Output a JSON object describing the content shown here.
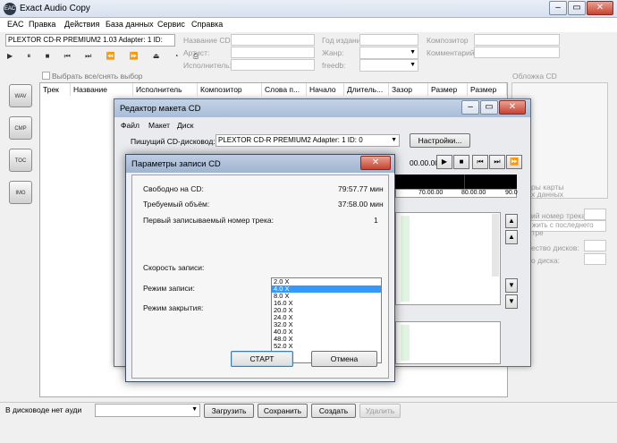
{
  "window": {
    "title": "Exact Audio Copy",
    "app_badge": "EAC"
  },
  "menu": [
    "EAC",
    "Правка",
    "Действия",
    "База данных",
    "Сервис",
    "Справка"
  ],
  "drive_combo": "PLEXTOR CD-R   PREMIUM2 1.03  Adapter: 1  ID: ",
  "cd_fields": {
    "name_label": "Название CD",
    "artist_label": "Артист:",
    "performer_label": "Исполнитель:",
    "year_label": "Год издания",
    "genre_label": "Жанр:",
    "freedb_label": "freedb:",
    "composer_label": "Композитор",
    "comment_label": "Комментарий"
  },
  "select_all": "Выбрать все/снять выбор",
  "cover_label": "Обложка CD",
  "columns": [
    "Трек",
    "Название",
    "Исполнитель",
    "Композитор",
    "Слова п...",
    "Начало",
    "Длитель...",
    "Зазор",
    "Размер",
    "Размер"
  ],
  "side_icons": [
    "WAV",
    "CMP",
    "TOC",
    "IMG"
  ],
  "right_panel": [
    "ры карты",
    "х данных",
    "ий номер трека:",
    "жить с последнего тре",
    "ество дисков:",
    "о диска:"
  ],
  "bottom": {
    "status": "В дисководе нет ауди",
    "load": "Загрузить",
    "save": "Сохранить",
    "create": "Создать",
    "delete": "Удалить"
  },
  "editor": {
    "title": "Редактор макета CD",
    "menu": [
      "Файл",
      "Макет",
      "Диск"
    ],
    "writer_label": "Пишущий CD-дисковод:",
    "writer_combo": "PLEXTOR CD-R  PREMIUM2  Adapter: 1  ID: 0",
    "settings_button": "Настройки...",
    "time": "00.00.00",
    "timeline_ticks": [
      "70.00.00",
      "80.00.00",
      "90.0"
    ]
  },
  "burn": {
    "title": "Параметры записи CD",
    "free_label": "Свободно на CD:",
    "free_value": "79:57.77 мин",
    "required_label": "Требуемый объём:",
    "required_value": "37:58.00 мин",
    "first_track_label": "Первый записываемый номер трека:",
    "first_track_value": "1",
    "speed_label": "Скорость записи:",
    "mode_label": "Режим записи:",
    "close_label": "Режим закрытия:",
    "speeds": [
      "2.0 X",
      "4.0 X",
      "8.0 X",
      "16.0 X",
      "20.0 X",
      "24.0 X",
      "32.0 X",
      "40.0 X",
      "48.0 X",
      "52.0 X"
    ],
    "selected_speed_index": 1,
    "start_button": "СТАРТ",
    "cancel_button": "Отмена"
  }
}
